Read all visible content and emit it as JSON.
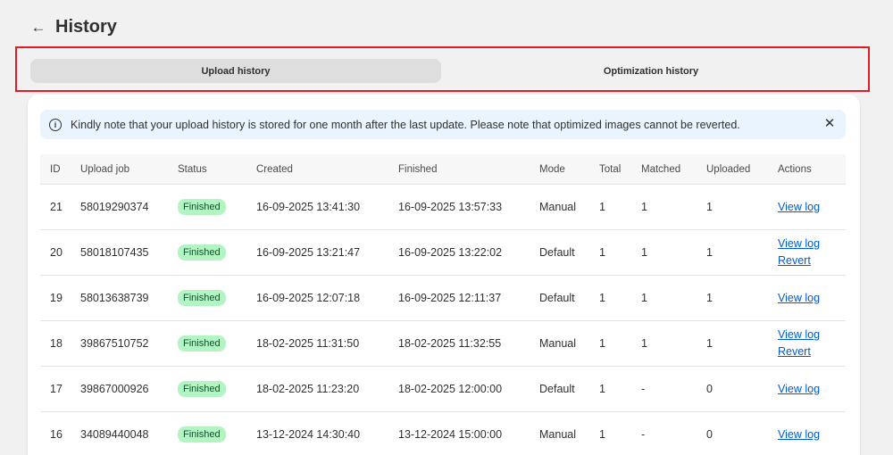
{
  "page": {
    "title": "History",
    "back_icon": "arrow-left-icon"
  },
  "tabs": [
    {
      "label": "Upload history",
      "active": true
    },
    {
      "label": "Optimization history",
      "active": false
    }
  ],
  "banner": {
    "text": "Kindly note that your upload history is stored for one month after the last update. Please note that optimized images cannot be reverted.",
    "info_icon": "i",
    "close_icon": "✕"
  },
  "table": {
    "columns": [
      "ID",
      "Upload job",
      "Status",
      "Created",
      "Finished",
      "Mode",
      "Total",
      "Matched",
      "Uploaded",
      "Actions"
    ],
    "rows": [
      {
        "id": "21",
        "job": "58019290374",
        "status": "Finished",
        "created": "16-09-2025 13:41:30",
        "finished": "16-09-2025 13:57:33",
        "mode": "Manual",
        "total": "1",
        "matched": "1",
        "uploaded": "1",
        "actions": [
          "View log"
        ]
      },
      {
        "id": "20",
        "job": "58018107435",
        "status": "Finished",
        "created": "16-09-2025 13:21:47",
        "finished": "16-09-2025 13:22:02",
        "mode": "Default",
        "total": "1",
        "matched": "1",
        "uploaded": "1",
        "actions": [
          "View log",
          "Revert"
        ]
      },
      {
        "id": "19",
        "job": "58013638739",
        "status": "Finished",
        "created": "16-09-2025 12:07:18",
        "finished": "16-09-2025 12:11:37",
        "mode": "Default",
        "total": "1",
        "matched": "1",
        "uploaded": "1",
        "actions": [
          "View log"
        ]
      },
      {
        "id": "18",
        "job": "39867510752",
        "status": "Finished",
        "created": "18-02-2025 11:31:50",
        "finished": "18-02-2025 11:32:55",
        "mode": "Manual",
        "total": "1",
        "matched": "1",
        "uploaded": "1",
        "actions": [
          "View log",
          "Revert"
        ]
      },
      {
        "id": "17",
        "job": "39867000926",
        "status": "Finished",
        "created": "18-02-2025 11:23:20",
        "finished": "18-02-2025 12:00:00",
        "mode": "Default",
        "total": "1",
        "matched": "-",
        "uploaded": "0",
        "actions": [
          "View log"
        ]
      },
      {
        "id": "16",
        "job": "34089440048",
        "status": "Finished",
        "created": "13-12-2024 14:30:40",
        "finished": "13-12-2024 15:00:00",
        "mode": "Manual",
        "total": "1",
        "matched": "-",
        "uploaded": "0",
        "actions": [
          "View log"
        ]
      }
    ]
  },
  "colors": {
    "badge_bg": "#b3f5c2",
    "link": "#005bd3",
    "banner_bg": "#eaf4ff",
    "highlight": "#e01b24"
  }
}
